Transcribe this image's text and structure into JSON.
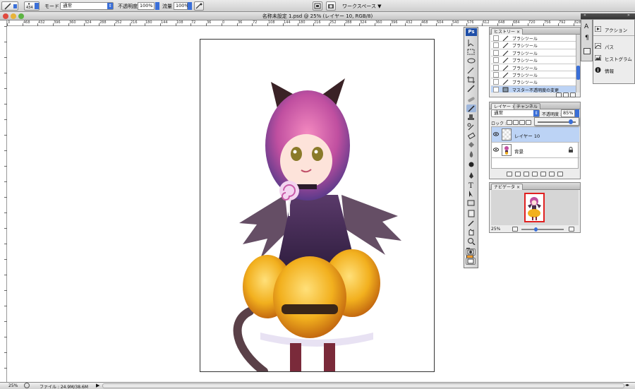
{
  "options_bar": {
    "brush_size": "434",
    "mode_label": "モード :",
    "mode_value": "通常",
    "opacity_label": "不透明度 :",
    "opacity_value": "100%",
    "flow_label": "流量 :",
    "flow_value": "100%",
    "workspace_label": "ワークスペース ▼"
  },
  "document": {
    "title": "名称未設定 1.psd @ 25% (レイヤー 10, RGB/8)"
  },
  "ruler": {
    "h_numbers": [
      "0",
      "468",
      "432",
      "396",
      "360",
      "324",
      "288",
      "252",
      "216",
      "180",
      "144",
      "108",
      "72",
      "36",
      "0",
      "36",
      "72",
      "108",
      "144",
      "180",
      "216",
      "252",
      "288",
      "324",
      "360",
      "396",
      "432",
      "468",
      "504",
      "540",
      "576",
      "612",
      "648",
      "684",
      "720",
      "756",
      "792",
      "828",
      "864",
      "900",
      "936"
    ]
  },
  "status": {
    "zoom": "25%",
    "file_info": "ファイル : 24.9M/38.6M"
  },
  "tools": {
    "ps_label": "Ps",
    "foreground_color": "#f09a2a",
    "background_color": "#111111"
  },
  "history": {
    "tab": "ヒストリー",
    "items": [
      "ブラシツール",
      "ブラシツール",
      "ブラシツール",
      "ブラシツール",
      "ブラシツール",
      "ブラシツール",
      "ブラシツール",
      "マスター不透明度の変更"
    ]
  },
  "layers": {
    "tab": "レイヤー",
    "channels_tab": "チャンネル",
    "blend_mode": "通常",
    "opacity_label": "不透明度 :",
    "opacity_value": "85%",
    "lock_label": "ロック :",
    "items": [
      {
        "name": "レイヤー 10",
        "selected": true
      },
      {
        "name": "背景",
        "selected": false,
        "locked": true
      }
    ]
  },
  "navigator": {
    "tab": "ナビゲータ",
    "zoom": "25%"
  },
  "dock": {
    "items": [
      "アクション",
      "パス",
      "ヒストグラム",
      "情報"
    ]
  },
  "colors": {
    "accent": "#3a6fd8",
    "selected_row": "#bcd3f5",
    "navigator_frame": "#e02020"
  }
}
